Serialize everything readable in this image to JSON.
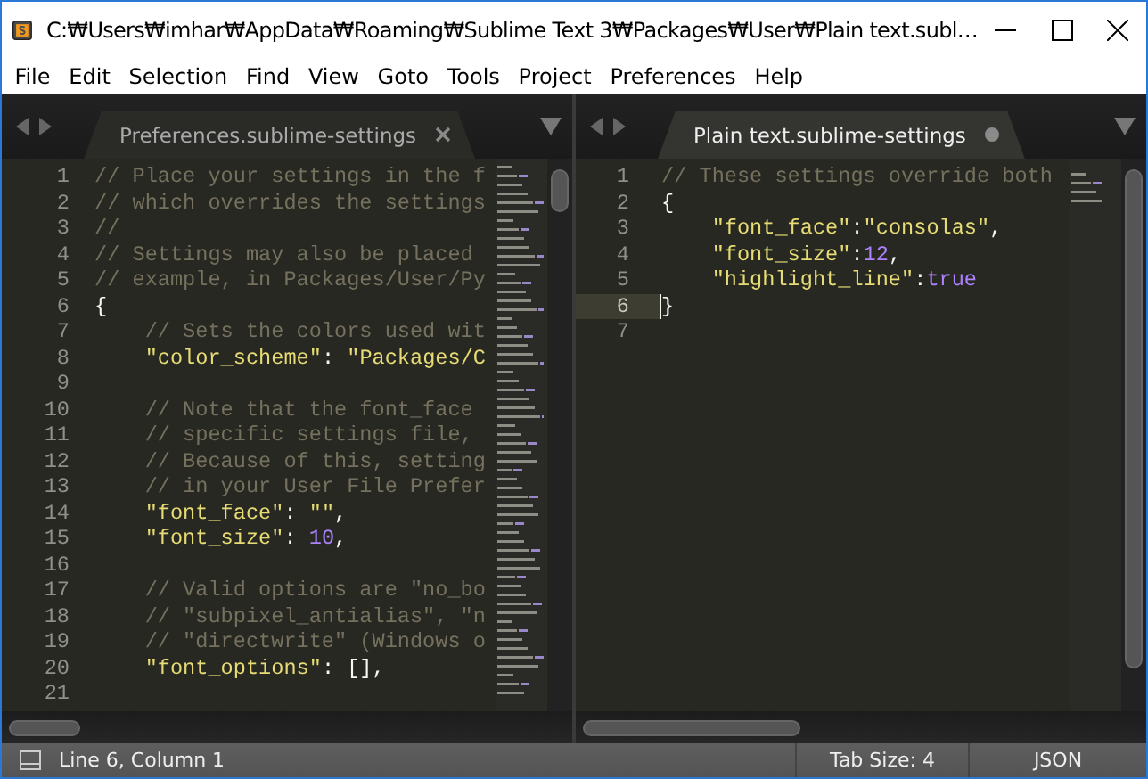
{
  "window": {
    "title": "C:₩Users₩imhar₩AppData₩Roaming₩Sublime Text 3₩Packages₩User₩Plain text.subl…"
  },
  "menu": [
    "File",
    "Edit",
    "Selection",
    "Find",
    "View",
    "Goto",
    "Tools",
    "Project",
    "Preferences",
    "Help"
  ],
  "panes": [
    {
      "active": false,
      "tab": {
        "label": "Preferences.sublime-settings",
        "dirty": false
      },
      "lines": [
        {
          "number": "1",
          "current": false,
          "tokens": [
            {
              "kind": "comment",
              "text": "// Place your settings in the f"
            }
          ]
        },
        {
          "number": "2",
          "current": false,
          "tokens": [
            {
              "kind": "comment",
              "text": "// which overrides the settings"
            }
          ]
        },
        {
          "number": "3",
          "current": false,
          "tokens": [
            {
              "kind": "comment",
              "text": "//"
            }
          ]
        },
        {
          "number": "4",
          "current": false,
          "tokens": [
            {
              "kind": "comment",
              "text": "// Settings may also be placed"
            }
          ]
        },
        {
          "number": "5",
          "current": false,
          "tokens": [
            {
              "kind": "comment",
              "text": "// example, in Packages/User/Py"
            }
          ]
        },
        {
          "number": "6",
          "current": false,
          "tokens": [
            {
              "kind": "punct",
              "text": "{"
            }
          ]
        },
        {
          "number": "7",
          "current": false,
          "tokens": [
            {
              "kind": "comment",
              "text": "    // Sets the colors used wit"
            }
          ]
        },
        {
          "number": "8",
          "current": false,
          "tokens": [
            {
              "kind": "string",
              "text": "    \"color_scheme\""
            },
            {
              "kind": "punct",
              "text": ": "
            },
            {
              "kind": "string",
              "text": "\"Packages/C"
            }
          ]
        },
        {
          "number": "9",
          "current": false
        },
        {
          "number": "10",
          "current": false,
          "tokens": [
            {
              "kind": "comment",
              "text": "    // Note that the font_face"
            }
          ]
        },
        {
          "number": "11",
          "current": false,
          "tokens": [
            {
              "kind": "comment",
              "text": "    // specific settings file,"
            }
          ]
        },
        {
          "number": "12",
          "current": false,
          "tokens": [
            {
              "kind": "comment",
              "text": "    // Because of this, setting"
            }
          ]
        },
        {
          "number": "13",
          "current": false,
          "tokens": [
            {
              "kind": "comment",
              "text": "    // in your User File Prefer"
            }
          ]
        },
        {
          "number": "14",
          "current": false,
          "tokens": [
            {
              "kind": "string",
              "text": "    \"font_face\""
            },
            {
              "kind": "punct",
              "text": ": "
            },
            {
              "kind": "string",
              "text": "\"\""
            },
            {
              "kind": "punct",
              "text": ","
            }
          ]
        },
        {
          "number": "15",
          "current": false,
          "tokens": [
            {
              "kind": "string",
              "text": "    \"font_size\""
            },
            {
              "kind": "punct",
              "text": ": "
            },
            {
              "kind": "number",
              "text": "10"
            },
            {
              "kind": "punct",
              "text": ","
            }
          ]
        },
        {
          "number": "16",
          "current": false
        },
        {
          "number": "17",
          "current": false,
          "tokens": [
            {
              "kind": "comment",
              "text": "    // Valid options are \"no_bo"
            }
          ]
        },
        {
          "number": "18",
          "current": false,
          "tokens": [
            {
              "kind": "comment",
              "text": "    // \"subpixel_antialias\", \"n"
            }
          ]
        },
        {
          "number": "19",
          "current": false,
          "tokens": [
            {
              "kind": "comment",
              "text": "    // \"directwrite\" (Windows o"
            }
          ]
        },
        {
          "number": "20",
          "current": false,
          "tokens": [
            {
              "kind": "string",
              "text": "    \"font_options\""
            },
            {
              "kind": "punct",
              "text": ": [],"
            }
          ]
        },
        {
          "number": "21",
          "current": false
        }
      ]
    },
    {
      "active": true,
      "tab": {
        "label": "Plain text.sublime-settings",
        "dirty": true
      },
      "lines": [
        {
          "number": "1",
          "current": false,
          "tokens": [
            {
              "kind": "comment",
              "text": "// These settings override both"
            }
          ]
        },
        {
          "number": "2",
          "current": false,
          "tokens": [
            {
              "kind": "punct",
              "text": "{"
            }
          ]
        },
        {
          "number": "3",
          "current": false,
          "tokens": [
            {
              "kind": "string",
              "text": "    \"font_face\""
            },
            {
              "kind": "punct",
              "text": ":"
            },
            {
              "kind": "string",
              "text": "\"consolas\""
            },
            {
              "kind": "punct",
              "text": ","
            }
          ]
        },
        {
          "number": "4",
          "current": false,
          "tokens": [
            {
              "kind": "string",
              "text": "    \"font_size\""
            },
            {
              "kind": "punct",
              "text": ":"
            },
            {
              "kind": "number",
              "text": "12"
            },
            {
              "kind": "punct",
              "text": ","
            }
          ]
        },
        {
          "number": "5",
          "current": false,
          "tokens": [
            {
              "kind": "string",
              "text": "    \"highlight_line\""
            },
            {
              "kind": "punct",
              "text": ":"
            },
            {
              "kind": "keyword",
              "text": "true"
            }
          ]
        },
        {
          "number": "6",
          "current": true,
          "tokens": [
            {
              "kind": "punct",
              "text": "}"
            }
          ]
        },
        {
          "number": "7",
          "current": false
        }
      ]
    }
  ],
  "status_bar": {
    "position": "Line 6, Column 1",
    "tab_size": "Tab Size: 4",
    "syntax": "JSON"
  }
}
